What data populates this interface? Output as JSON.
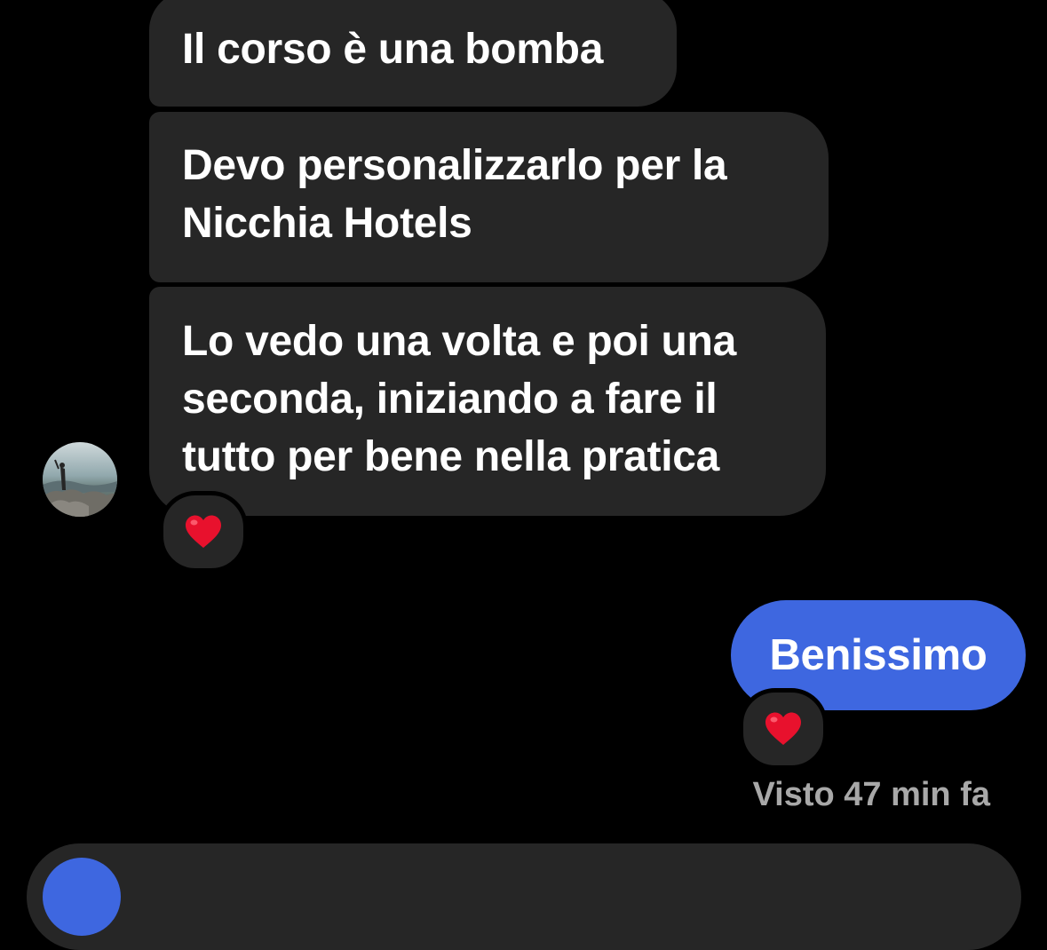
{
  "conversation": {
    "incoming_messages": [
      {
        "text": "Il corso è una bomba"
      },
      {
        "text": "Devo personalizzarlo per la\nNicchia Hotels"
      },
      {
        "text": "Lo vedo una volta e poi una\nseconda, iniziando a fare il\ntutto per bene nella pratica"
      }
    ],
    "incoming_reaction": "heart-reaction",
    "outgoing_message": {
      "text": "Benissimo"
    },
    "outgoing_reaction": "heart-reaction",
    "seen_status": "Visto 47 min fa"
  },
  "colors": {
    "background": "#000000",
    "incoming_bubble": "#262626",
    "outgoing_bubble": "#3e67e0",
    "heart": "#e8112d",
    "seen_text": "#a8a8a8"
  },
  "icons": {
    "avatar": "profile-photo",
    "heart": "heart-icon",
    "composer_button": "camera-button"
  }
}
